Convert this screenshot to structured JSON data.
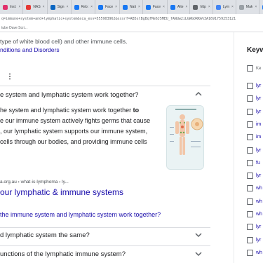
{
  "browser": {
    "tabs": [
      {
        "label": "Inst:",
        "color": "#e1306c"
      },
      {
        "label": "NAS",
        "color": "#e53935"
      },
      {
        "label": "Sign",
        "color": "#0a66c2"
      },
      {
        "label": "Reb:",
        "color": "#1877f2"
      },
      {
        "label": "Face",
        "color": "#1877f2"
      },
      {
        "label": "Nati",
        "color": "#1877f2"
      },
      {
        "label": "Face",
        "color": "#1877f2"
      },
      {
        "label": "Alte",
        "color": "#1877f2"
      },
      {
        "label": "http",
        "color": "#5f6368"
      },
      {
        "label": "Lym",
        "color": "#4285f4"
      },
      {
        "label": "Mak",
        "color": "#9aa0a6"
      },
      {
        "label": "Reb:",
        "color": "#1877f2"
      },
      {
        "label": "Mer",
        "color": "#d93025"
      },
      {
        "label": "The",
        "color": "#4285f4"
      }
    ],
    "url": "q=immune+system+and+lymphatic+system&sca_esv=555903962&sxsrf=AB5stBgBqfMe6J5MEU_fANdw2iLGWGORKA%3A1691759253121",
    "bookmark": "tube Dave Scri..."
  },
  "snippet": {
    "text": "type of white blood cell) and other immune cells.",
    "link": "nditions and Disorders"
  },
  "faq": [
    {
      "question": "e system and lymphatic system work together?",
      "chevron": "up"
    },
    {
      "question": "d lymphatic system the same?",
      "chevron": "down"
    },
    {
      "question": "unctions of the lymphatic immune system?",
      "chevron": "down"
    }
  ],
  "answer": {
    "line1_pre": "he system and lymphatic system work together ",
    "line1_bold": "to",
    "line2": "e our immune system actively fights germs that cause",
    "line3": ", our lymphatic system supports our immune system,",
    "line4": "cells through our bodies, and providing immune cells"
  },
  "result": {
    "url": "a.org.au › what-is-lymphoma › ly...",
    "title": "our lymphatic & immune systems",
    "subtitle": "the immune system and lymphatic system work together?"
  },
  "sidebar": {
    "title": "Keyw",
    "first_label": "Ke",
    "items": [
      "lyr",
      "lyr",
      "lyr",
      "im",
      "im",
      "lyr",
      "fu",
      "lyr",
      "wh",
      "wh",
      "wh",
      "lyr",
      "lyr",
      "wh"
    ]
  },
  "icons": {
    "more": "more-vert-icon",
    "chevron_up": "chevron-up-icon",
    "chevron_down": "chevron-down-icon"
  }
}
